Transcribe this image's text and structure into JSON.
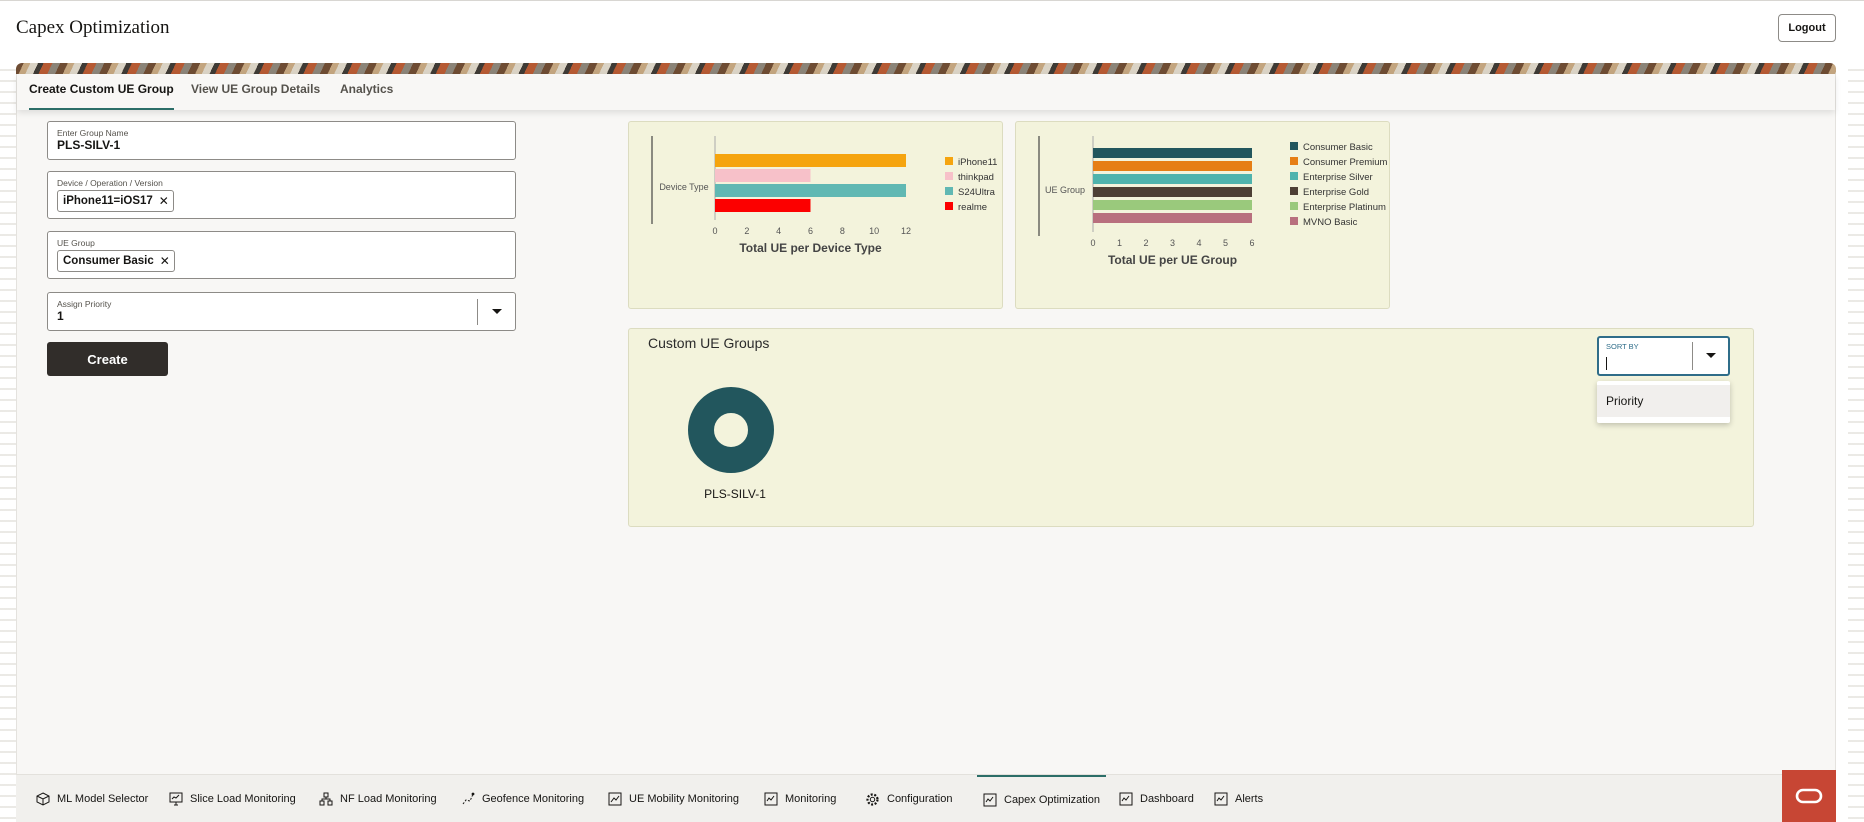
{
  "app": {
    "title": "Capex Optimization",
    "logout_label": "Logout"
  },
  "tabs": [
    {
      "label": "Create Custom UE Group",
      "active": true
    },
    {
      "label": "View UE Group Details",
      "active": false
    },
    {
      "label": "Analytics",
      "active": false
    }
  ],
  "form": {
    "group_name": {
      "label": "Enter Group Name",
      "value": "PLS-SILV-1"
    },
    "device": {
      "label": "Device / Operation / Version",
      "chip": "iPhone11=iOS17"
    },
    "ue_group": {
      "label": "UE Group",
      "chip": "Consumer Basic"
    },
    "priority": {
      "label": "Assign Priority",
      "value": "1"
    },
    "create_label": "Create"
  },
  "colors": {
    "accent": "#2c6e68",
    "panel_bg": "#f3f3dc",
    "oracle_red": "#c74634",
    "focus_blue": "#2f6d89"
  },
  "chart_data": [
    {
      "type": "bar",
      "orientation": "horizontal",
      "title": "Total UE per Device Type",
      "ylabel": "Device Type",
      "xlim": [
        0,
        12
      ],
      "xticks": [
        0,
        2,
        4,
        6,
        8,
        10,
        12
      ],
      "categories": [
        "iPhone11",
        "thinkpad",
        "S24Ultra",
        "realme"
      ],
      "values": [
        12,
        6,
        12,
        6
      ],
      "colors": [
        "#f5a40f",
        "#f7c1c9",
        "#60b8b3",
        "#fc0000"
      ],
      "legend": {
        "position": "right",
        "entries": [
          "iPhone11",
          "thinkpad",
          "S24Ultra",
          "realme"
        ]
      }
    },
    {
      "type": "bar",
      "orientation": "horizontal",
      "title": "Total UE per UE Group",
      "ylabel": "UE Group",
      "xlim": [
        0,
        6
      ],
      "xticks": [
        0,
        1,
        2,
        3,
        4,
        5,
        6
      ],
      "categories": [
        "Consumer Basic",
        "Consumer Premium",
        "Enterprise Silver",
        "Enterprise Gold",
        "Enterprise Platinum",
        "MVNO Basic"
      ],
      "values": [
        6,
        6,
        6,
        6,
        6,
        6
      ],
      "colors": [
        "#22565d",
        "#e67e15",
        "#4fb3ad",
        "#4d3f35",
        "#9ac97c",
        "#b86f7e"
      ],
      "legend": {
        "position": "right",
        "entries": [
          "Consumer Basic",
          "Consumer Premium",
          "Enterprise Silver",
          "Enterprise Gold",
          "Enterprise Platinum",
          "MVNO Basic"
        ]
      }
    }
  ],
  "custom_groups": {
    "title": "Custom UE Groups",
    "sort": {
      "label": "SORT BY",
      "value": "",
      "options": [
        "Priority"
      ]
    },
    "items": [
      {
        "name": "PLS-SILV-1",
        "color": "#22565d"
      }
    ]
  },
  "bottom_nav": [
    {
      "label": "ML Model Selector",
      "icon": "cube-icon",
      "active": false
    },
    {
      "label": "Slice Load Monitoring",
      "icon": "monitor-chart-icon",
      "active": false
    },
    {
      "label": "NF Load Monitoring",
      "icon": "network-tree-icon",
      "active": false
    },
    {
      "label": "Geofence Monitoring",
      "icon": "route-icon",
      "active": false
    },
    {
      "label": "UE Mobility Monitoring",
      "icon": "device-chart-icon",
      "active": false
    },
    {
      "label": "Monitoring",
      "icon": "chart-board-icon",
      "active": false
    },
    {
      "label": "Configuration",
      "icon": "gear-icon",
      "active": false
    },
    {
      "label": "Capex Optimization",
      "icon": "chart-board-icon",
      "active": true
    },
    {
      "label": "Dashboard",
      "icon": "chart-board-icon",
      "active": false
    },
    {
      "label": "Alerts",
      "icon": "chart-board-icon",
      "active": false
    }
  ]
}
